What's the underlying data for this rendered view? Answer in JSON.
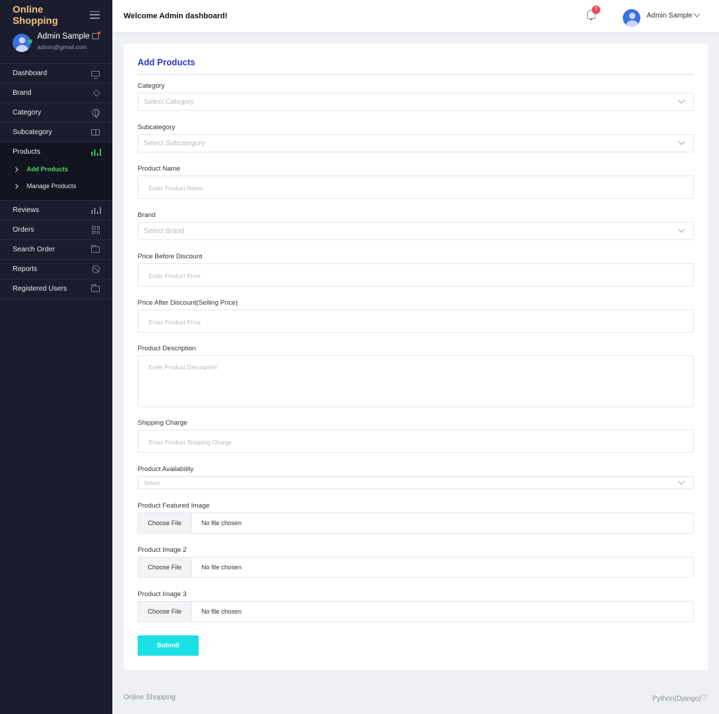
{
  "sidebar": {
    "brand": "Online Shopping",
    "profile": {
      "name": "Admin Sample",
      "email": "admin@gmail.com"
    },
    "items": [
      {
        "label": "Dashboard",
        "icon": "monitor-icon"
      },
      {
        "label": "Brand",
        "icon": "layers-icon"
      },
      {
        "label": "Category",
        "icon": "globe-icon"
      },
      {
        "label": "Subcategory",
        "icon": "book-icon"
      },
      {
        "label": "Products",
        "icon": "bar-chart-icon"
      },
      {
        "label": "Reviews",
        "icon": "bar-chart-icon"
      },
      {
        "label": "Orders",
        "icon": "grid-icon"
      },
      {
        "label": "Search Order",
        "icon": "folder-icon"
      },
      {
        "label": "Reports",
        "icon": "ban-icon"
      },
      {
        "label": "Registered Users",
        "icon": "folder-icon"
      }
    ],
    "submenu": [
      {
        "label": "Add Products"
      },
      {
        "label": "Manage Products"
      }
    ]
  },
  "header": {
    "welcome": "Welcome Admin dashboard!",
    "notification_count": "7",
    "user_name": "Admin Sample"
  },
  "form": {
    "title": "Add Products",
    "category": {
      "label": "Category",
      "placeholder": "Select Category"
    },
    "subcategory": {
      "label": "Subcategory",
      "placeholder": "Select Subcategory"
    },
    "product_name": {
      "label": "Product Name",
      "placeholder": "Enter Product Name"
    },
    "brand": {
      "label": "Brand",
      "placeholder": "Select Brand"
    },
    "price_before": {
      "label": "Price Before Discount",
      "placeholder": "Enter Product Price"
    },
    "price_after": {
      "label": "Price After Discount(Selling Price)",
      "placeholder": "Enter Product Price"
    },
    "description": {
      "label": "Product Description",
      "placeholder": "Enter Product Description"
    },
    "shipping": {
      "label": "Shipping Charge",
      "placeholder": "Enter Product Shipping Charge"
    },
    "availability": {
      "label": "Product Availability",
      "placeholder": "Select"
    },
    "image1": {
      "label": "Product Featured Image",
      "button": "Choose File",
      "status": "No file chosen"
    },
    "image2": {
      "label": "Product Image 2",
      "button": "Choose File",
      "status": "No file chosen"
    },
    "image3": {
      "label": "Product Image 3",
      "button": "Choose File",
      "status": "No file chosen"
    },
    "submit": "Submit"
  },
  "footer": {
    "left": "Online Shopping",
    "right": "Python(Django)"
  },
  "colors": {
    "sidebar_bg": "#1b1d2e",
    "brand": "#f2c37e",
    "accent_green": "#4cd964",
    "title_blue": "#2b35c9",
    "submit": "#1de0e6",
    "badge": "#e84b5a"
  }
}
